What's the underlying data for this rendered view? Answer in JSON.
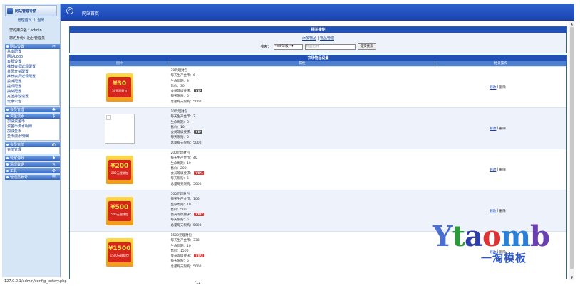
{
  "sidebar": {
    "logo_text": "网站管理导航",
    "top_links": [
      "管理首页",
      "退出"
    ],
    "top_sep": "|",
    "user_line": "您的用户名：admin",
    "role_line": "您的身份：后台管理员",
    "groups": [
      {
        "title": "网站设置",
        "icon": "tools-icon",
        "items": [
          "基本配置",
          "网站Logo",
          "客服设置",
          "推荐会员返现配置",
          "首页开奖配置",
          "推荐会员返现配置",
          "投诉配置",
          "提现配置",
          "抽奖配置",
          "充值排返设置",
          "玩家公告"
        ]
      },
      {
        "title": "会员管理",
        "icon": "users-icon",
        "items": []
      },
      {
        "title": "资金流水",
        "icon": "money-icon",
        "items": [
          "加减资金币",
          "资金币流水明细",
          "加减金币",
          "金币流水明细"
        ]
      },
      {
        "title": "会员充值",
        "icon": "recharge-icon",
        "items": [
          "充值管理"
        ]
      },
      {
        "title": "玩家游戏",
        "icon": "game-icon",
        "items": []
      },
      {
        "title": "清理数据",
        "icon": "clean-icon",
        "items": []
      },
      {
        "title": "工具",
        "icon": "tool-icon",
        "items": []
      },
      {
        "title": "管理员账号",
        "icon": "admin-icon",
        "items": []
      }
    ]
  },
  "header": {
    "title": "网站首页",
    "icon": "home-icon"
  },
  "ops": {
    "title": "相关操作",
    "links": [
      "添加物品",
      "物品管理"
    ],
    "links_sep": "|",
    "search_label": "搜索：",
    "select_value": "--VIP等级--",
    "search_placeholder": "物品名称",
    "search_button": "提交搜索"
  },
  "table": {
    "title": "农场物品设置",
    "columns": [
      "图片",
      "属性",
      "相关操作"
    ],
    "edit_label": "修改",
    "delete_label": "删除",
    "action_sep": "|",
    "rows": [
      {
        "image": {
          "amount": "¥30",
          "sub": "30元理财包",
          "broken": false
        },
        "lines": [
          "30元理财包",
          "每天生产金币：6",
          "生命周期：8",
          "售价：30",
          "会员等级要求：",
          "每天限购：5",
          "总量每天限购：5000"
        ],
        "vip": "VIP",
        "vip_red": false
      },
      {
        "image": {
          "amount": "",
          "sub": "",
          "broken": true
        },
        "lines": [
          "10元理财包",
          "每天生产金币：2",
          "生命周期：8",
          "售价：10",
          "会员等级要求：",
          "每天限购：5",
          "总量每天限购：5000"
        ],
        "vip": "VIP",
        "vip_red": false
      },
      {
        "image": {
          "amount": "¥200",
          "sub": "200元理财包",
          "broken": false
        },
        "lines": [
          "200元理财包",
          "每天生产金币：40",
          "生命周期：10",
          "售价：200",
          "会员等级要求：",
          "每天限购：5",
          "总量每天限购：5000"
        ],
        "vip": "VIP1",
        "vip_red": true
      },
      {
        "image": {
          "amount": "¥500",
          "sub": "500元理财包",
          "broken": false
        },
        "lines": [
          "500元理财包",
          "每天生产金币：106",
          "生命周期：10",
          "售价：500",
          "会员等级要求：",
          "每天限购：5",
          "总量每天限购：5000"
        ],
        "vip": "VIP2",
        "vip_red": true
      },
      {
        "image": {
          "amount": "¥1500",
          "sub": "1500元理财包",
          "broken": false
        },
        "lines": [
          "1500元理财包",
          "每天生产金币：338",
          "生命周期：10",
          "售价：1500",
          "会员等级要求：",
          "每天限购：5",
          "总量每天限购：5000"
        ],
        "vip": "VIP3",
        "vip_red": true
      }
    ]
  },
  "status_url": "127.0.0.1/admin/config_lottery.php",
  "page_num": "712",
  "watermark": {
    "brand": "Ytaomb",
    "cn": "一淘模板"
  }
}
